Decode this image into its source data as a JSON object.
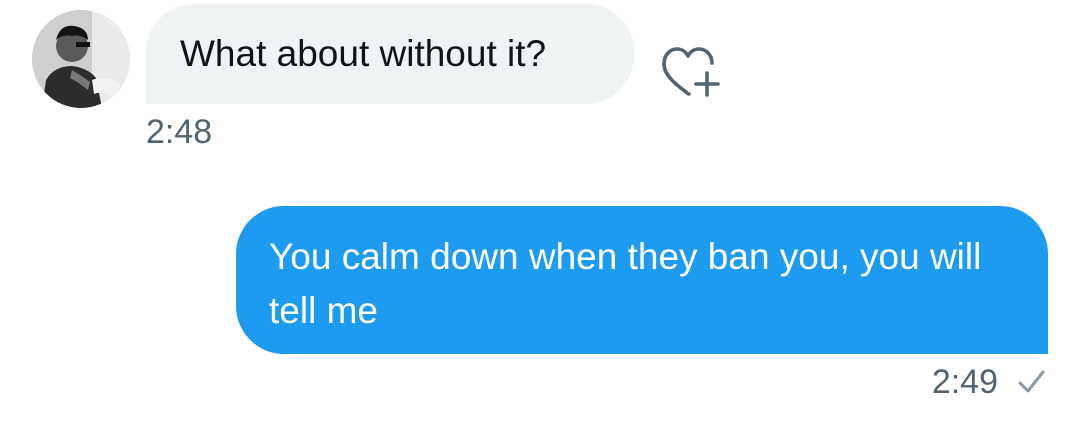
{
  "conversation": {
    "incoming": {
      "avatar_icon": "user-avatar",
      "text": "What about without it?",
      "time": "2:48",
      "reaction_icon": "heart-plus-icon"
    },
    "outgoing": {
      "text": "You calm down when they ban you, you will tell me",
      "time": "2:49",
      "status_icon": "checkmark-icon"
    }
  },
  "colors": {
    "incoming_bubble": "#eff3f4",
    "outgoing_bubble": "#1d9bf0",
    "timestamp": "#536471"
  }
}
